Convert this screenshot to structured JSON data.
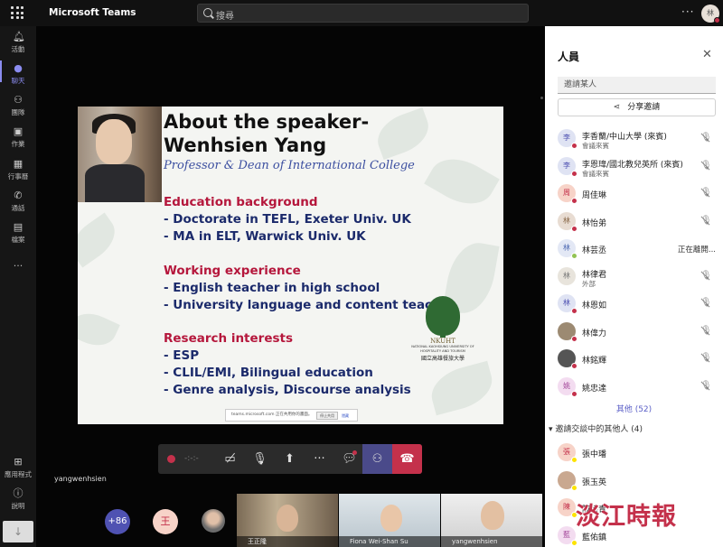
{
  "app": {
    "title": "Microsoft Teams",
    "user_initial": "林"
  },
  "search": {
    "placeholder": "搜尋"
  },
  "rail": [
    {
      "label": "活動",
      "icon": "bell-icon"
    },
    {
      "label": "聊天",
      "icon": "chat-icon",
      "active": true
    },
    {
      "label": "團隊",
      "icon": "teams-icon"
    },
    {
      "label": "作業",
      "icon": "assignments-icon"
    },
    {
      "label": "行事曆",
      "icon": "calendar-icon"
    },
    {
      "label": "通話",
      "icon": "phone-icon"
    },
    {
      "label": "檔案",
      "icon": "file-icon"
    },
    {
      "label": "...",
      "icon": "more-icon"
    },
    {
      "label": "應用程式",
      "icon": "apps-icon"
    },
    {
      "label": "說明",
      "icon": "help-icon"
    }
  ],
  "slide": {
    "title_line1": "About the speaker-",
    "title_line2": "Wenhsien Yang",
    "subtitle": "Professor & Dean of International College",
    "sections": [
      {
        "heading": "Education background",
        "lines": [
          "- Doctorate in TEFL, Exeter Univ. UK",
          "- MA in ELT, Warwick Univ. UK"
        ]
      },
      {
        "heading": "Working experience",
        "lines": [
          "- English teacher in high school",
          "- University language and content teacher"
        ]
      },
      {
        "heading": "Research interests",
        "lines": [
          "- ESP",
          "- CLIL/EMI, Bilingual education",
          "- Genre analysis, Discourse analysis"
        ]
      }
    ],
    "logo": {
      "abbr": "NKUHT",
      "university": "NATIONAL KAOHSIUNG UNIVERSITY OF HOSPITALITY AND TOURISM",
      "name_cn": "國立高雄餐旅大學"
    },
    "share_bar": {
      "text": "teams.microsoft.com 正在共用你的畫面。",
      "stop": "停止共用",
      "hide": "隱藏"
    }
  },
  "controls": {
    "timer": "-:-:-"
  },
  "presenter_name": "yangwenhsien",
  "tiles": {
    "more_count": "+86",
    "avatar_initial": "王",
    "video": [
      {
        "caption": "王正隆"
      },
      {
        "caption": "Fiona Wei-Shan Su"
      },
      {
        "caption": "yangwenhsien"
      }
    ]
  },
  "panel": {
    "title": "人員",
    "invite_placeholder": "邀請某人",
    "share_invite": "分享邀請",
    "people": [
      {
        "initial": "李",
        "name": "李香蘭/中山大學 (來賓)",
        "sub": "會議來賓",
        "avatar_bg": "#dfe3f3",
        "avatar_fg": "#4f52b2",
        "status": "#c4314b"
      },
      {
        "initial": "李",
        "name": "李恩瑋/國北教兒英所 (來賓)",
        "sub": "會議來賓",
        "avatar_bg": "#dfe3f3",
        "avatar_fg": "#4f52b2",
        "status": "#c4314b"
      },
      {
        "initial": "周",
        "name": "周佳琳",
        "sub": "",
        "avatar_bg": "#f7d3c8",
        "avatar_fg": "#c4314b",
        "status": "#c4314b"
      },
      {
        "initial": "林",
        "name": "林怡弟",
        "sub": "",
        "avatar_bg": "#e8dcd2",
        "avatar_fg": "#8a6a4a",
        "status": "#c4314b"
      },
      {
        "initial": "林",
        "name": "林芸丞",
        "sub": "",
        "avatar_bg": "#e3e8f5",
        "avatar_fg": "#4f6ab2",
        "status": "#92c353",
        "status_text": "正在離開..."
      },
      {
        "initial": "林",
        "name": "林律君",
        "sub": "外部",
        "avatar_bg": "#e8e4dc",
        "avatar_fg": "#777",
        "status": ""
      },
      {
        "initial": "林",
        "name": "林恩如",
        "sub": "",
        "avatar_bg": "#dfe3f3",
        "avatar_fg": "#4f52b2",
        "status": "#c4314b"
      },
      {
        "initial": "",
        "name": "林偉力",
        "sub": "",
        "avatar_bg": "#9c8a72",
        "avatar_fg": "#fff",
        "status": "#c4314b"
      },
      {
        "initial": "",
        "name": "林銘輝",
        "sub": "",
        "avatar_bg": "#555",
        "avatar_fg": "#fff",
        "status": "#c4314b"
      },
      {
        "initial": "姚",
        "name": "姚忠達",
        "sub": "",
        "avatar_bg": "#f3dcf0",
        "avatar_fg": "#a3479a",
        "status": "#c4314b"
      }
    ],
    "others_label": "其他 (52)",
    "section_label": "邀請交談中的其他人 (4)",
    "invited": [
      {
        "initial": "張",
        "name": "張中璠",
        "avatar_bg": "#f7d3c8",
        "avatar_fg": "#c4314b",
        "status": "#fde300"
      },
      {
        "initial": "",
        "name": "張玉英",
        "avatar_bg": "#c9a890",
        "avatar_fg": "#fff",
        "status": "#fde300"
      },
      {
        "initial": "陳",
        "name": "陳詩青",
        "avatar_bg": "#f7d3c8",
        "avatar_fg": "#c4314b",
        "status": "#fde300"
      },
      {
        "initial": "藍",
        "name": "藍佑鎮",
        "avatar_bg": "#f3dcf0",
        "avatar_fg": "#a3479a",
        "status": "#fde300"
      }
    ]
  },
  "watermark": "淡江時報"
}
